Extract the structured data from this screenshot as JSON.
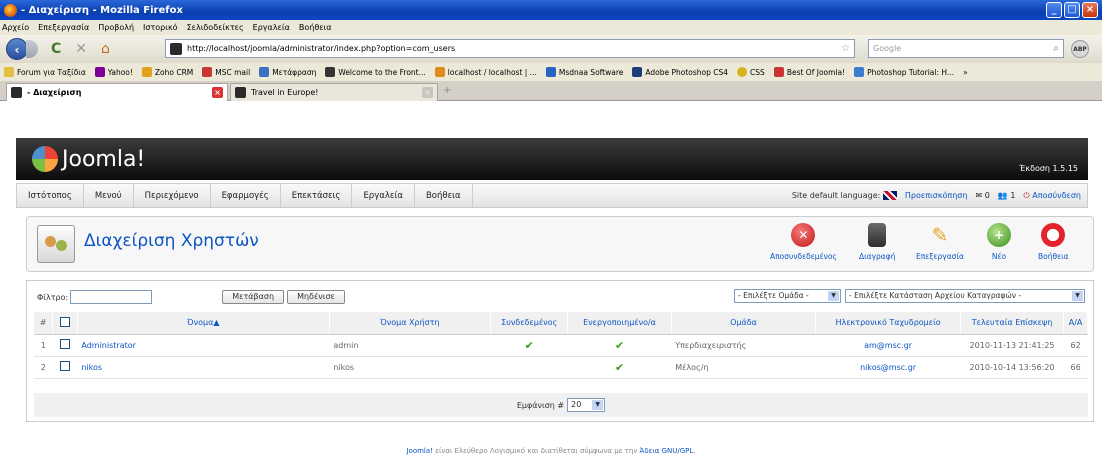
{
  "window": {
    "title": "- Διαχείριση - Mozilla Firefox"
  },
  "menubar": [
    "Αρχείο",
    "Επεξεργασία",
    "Προβολή",
    "Ιστορικό",
    "Σελιδοδείκτες",
    "Εργαλεία",
    "Βοήθεια"
  ],
  "nav": {
    "url": "http://localhost/joomla/administrator/index.php?option=com_users",
    "search_placeholder": "Google",
    "abp": "ABP"
  },
  "bookmarks": [
    "Forum για Ταξίδια",
    "Yahoo!",
    "Zoho CRM",
    "MSC mail",
    "Μετάφραση",
    "Welcome to the Front...",
    "localhost / localhost | ...",
    "Msdnaa Software",
    "Adobe Photoshop CS4",
    "CSS",
    "Best Of Joomla!",
    "Photoshop Tutorial: H...",
    "»"
  ],
  "tabs": [
    {
      "label": "- Διαχείριση"
    },
    {
      "label": "Travel in Europe!"
    }
  ],
  "joomla": {
    "logo": "Joomla!",
    "version": "Έκδοση 1.5.15",
    "menu": [
      "Ιστότοπος",
      "Μενού",
      "Περιεχόμενο",
      "Εφαρμογές",
      "Επεκτάσεις",
      "Εργαλεία",
      "Βοήθεια"
    ],
    "status": {
      "lang_label": "Site default language:",
      "preview": "Προεπισκόπηση",
      "count1": "0",
      "count2": "1",
      "logout": "Αποσύνδεση"
    },
    "page_title": "Διαχείριση Χρηστών",
    "toolbar": [
      "Αποσυνδεδεμένος",
      "Διαγραφή",
      "Επεξεργασία",
      "Νέο",
      "Βοήθεια"
    ],
    "filter": {
      "label": "Φίλτρο:",
      "go": "Μετάβαση",
      "reset": "Μηδένισε",
      "group_select": "- Επιλέξτε Ομάδα -",
      "log_select": "- Επιλέξτε Κατάσταση Αρχείου Καταγραφών -"
    },
    "columns": [
      "#",
      "",
      "Όνομα▲",
      "Όνομα Χρήστη",
      "Συνδεδεμένος",
      "Ενεργοποιημένο/α",
      "Ομάδα",
      "Ηλεκτρονικό Ταχυδρομείο",
      "Τελευταία Επίσκεψη",
      "Α/Α"
    ],
    "rows": [
      {
        "num": "1",
        "name": "Administrator",
        "username": "admin",
        "logged_in": true,
        "enabled": true,
        "group": "Υπερδιαχειριστής",
        "email": "am@msc.gr",
        "last_visit": "2010-11-13 21:41:25",
        "id": "62"
      },
      {
        "num": "2",
        "name": "nikos",
        "username": "nikos",
        "logged_in": false,
        "enabled": true,
        "group": "Μέλος/η",
        "email": "nikos@msc.gr",
        "last_visit": "2010-10-14 13:56:20",
        "id": "66"
      }
    ],
    "pagination": {
      "label": "Εμφάνιση #",
      "value": "20"
    },
    "footer": {
      "link": "Joomla!",
      "text": " είναι Ελεύθερο Λογισμικό και διατίθεται σύμφωνα με την ",
      "license": "Άδεια GNU/GPL",
      "end": "."
    }
  }
}
